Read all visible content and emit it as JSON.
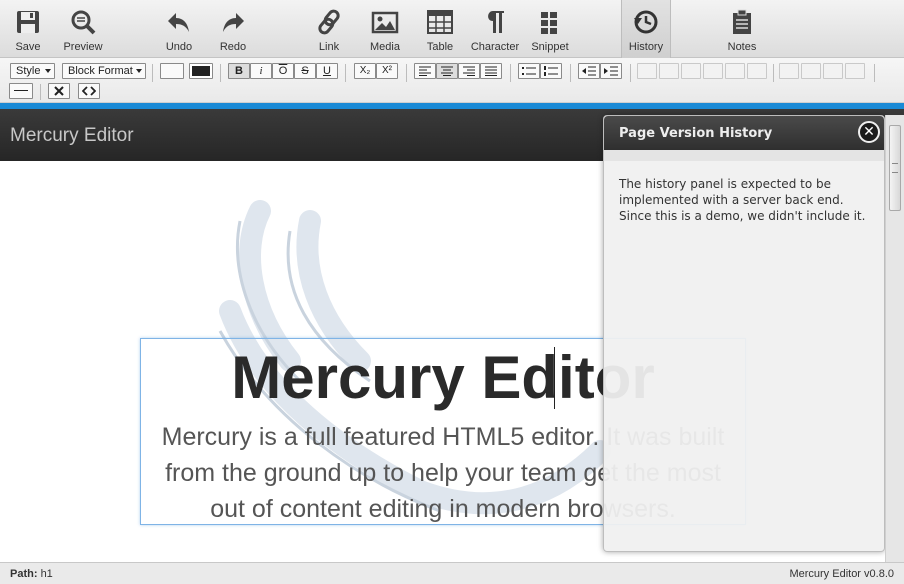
{
  "toolbar": {
    "save": "Save",
    "preview": "Preview",
    "undo": "Undo",
    "redo": "Redo",
    "link": "Link",
    "media": "Media",
    "table": "Table",
    "character": "Character",
    "snippet": "Snippet",
    "history": "History",
    "notes": "Notes"
  },
  "editbar": {
    "style_select": "Style",
    "block_format_select": "Block Format",
    "bold": "B",
    "italic": "i",
    "overline": "O",
    "strikethrough": "S",
    "underline": "U",
    "subscript": "X₂",
    "superscript": "X²"
  },
  "site": {
    "title": "Mercury Editor"
  },
  "content": {
    "heading": "Mercury Editor",
    "paragraph": "Mercury is a full featured HTML5 editor. It was built from the ground up to help your team get the most out of content editing in modern browsers."
  },
  "panel": {
    "title": "Page Version History",
    "body": "The history panel is expected to be implemented with a server back end. Since this is a demo, we didn't include it."
  },
  "status": {
    "path_label": "Path:",
    "path_value": "h1",
    "version": "Mercury Editor v0.8.0"
  },
  "colors": {
    "accent": "#1a8ad6",
    "header": "#2b2b2b"
  }
}
